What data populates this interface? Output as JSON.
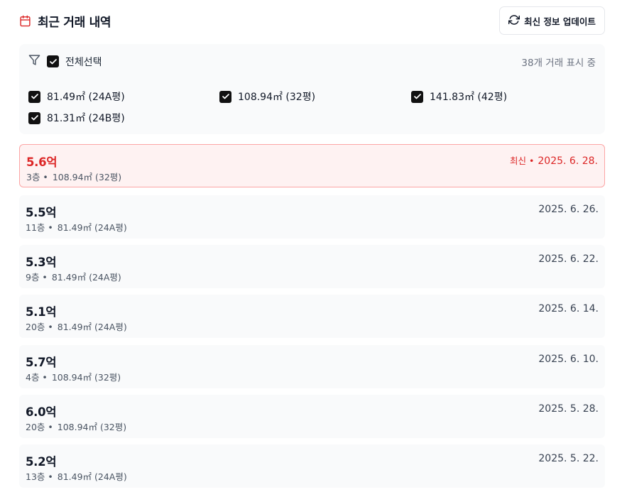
{
  "header": {
    "title": "최근 거래 내역",
    "refresh_label": "최신 정보 업데이트"
  },
  "filter": {
    "select_all_label": "전체선택",
    "count_label": "38개 거래 표시 중",
    "options": [
      {
        "label": "81.49㎡ (24A평)",
        "checked": true
      },
      {
        "label": "108.94㎡ (32평)",
        "checked": true
      },
      {
        "label": "141.83㎡ (42평)",
        "checked": true
      },
      {
        "label": "81.31㎡ (24B평)",
        "checked": true
      }
    ]
  },
  "colors": {
    "accent": "#dc2626",
    "checkbox": "#111111",
    "panel_bg": "#f9fafb"
  },
  "transactions": [
    {
      "price": "5.6억",
      "floor": "3층 •",
      "area": "108.94㎡ (32평)",
      "latest_tag": "최신 •",
      "date": "2025. 6. 28."
    },
    {
      "price": "5.5억",
      "floor": "11층 •",
      "area": "81.49㎡ (24A평)",
      "date": "2025. 6. 26."
    },
    {
      "price": "5.3억",
      "floor": "9층 •",
      "area": "81.49㎡ (24A평)",
      "date": "2025. 6. 22."
    },
    {
      "price": "5.1억",
      "floor": "20층 •",
      "area": "81.49㎡ (24A평)",
      "date": "2025. 6. 14."
    },
    {
      "price": "5.7억",
      "floor": "4층 •",
      "area": "108.94㎡ (32평)",
      "date": "2025. 6. 10."
    },
    {
      "price": "6.0억",
      "floor": "20층 •",
      "area": "108.94㎡ (32평)",
      "date": "2025. 5. 28."
    },
    {
      "price": "5.2억",
      "floor": "13층 •",
      "area": "81.49㎡ (24A평)",
      "date": "2025. 5. 22."
    }
  ]
}
